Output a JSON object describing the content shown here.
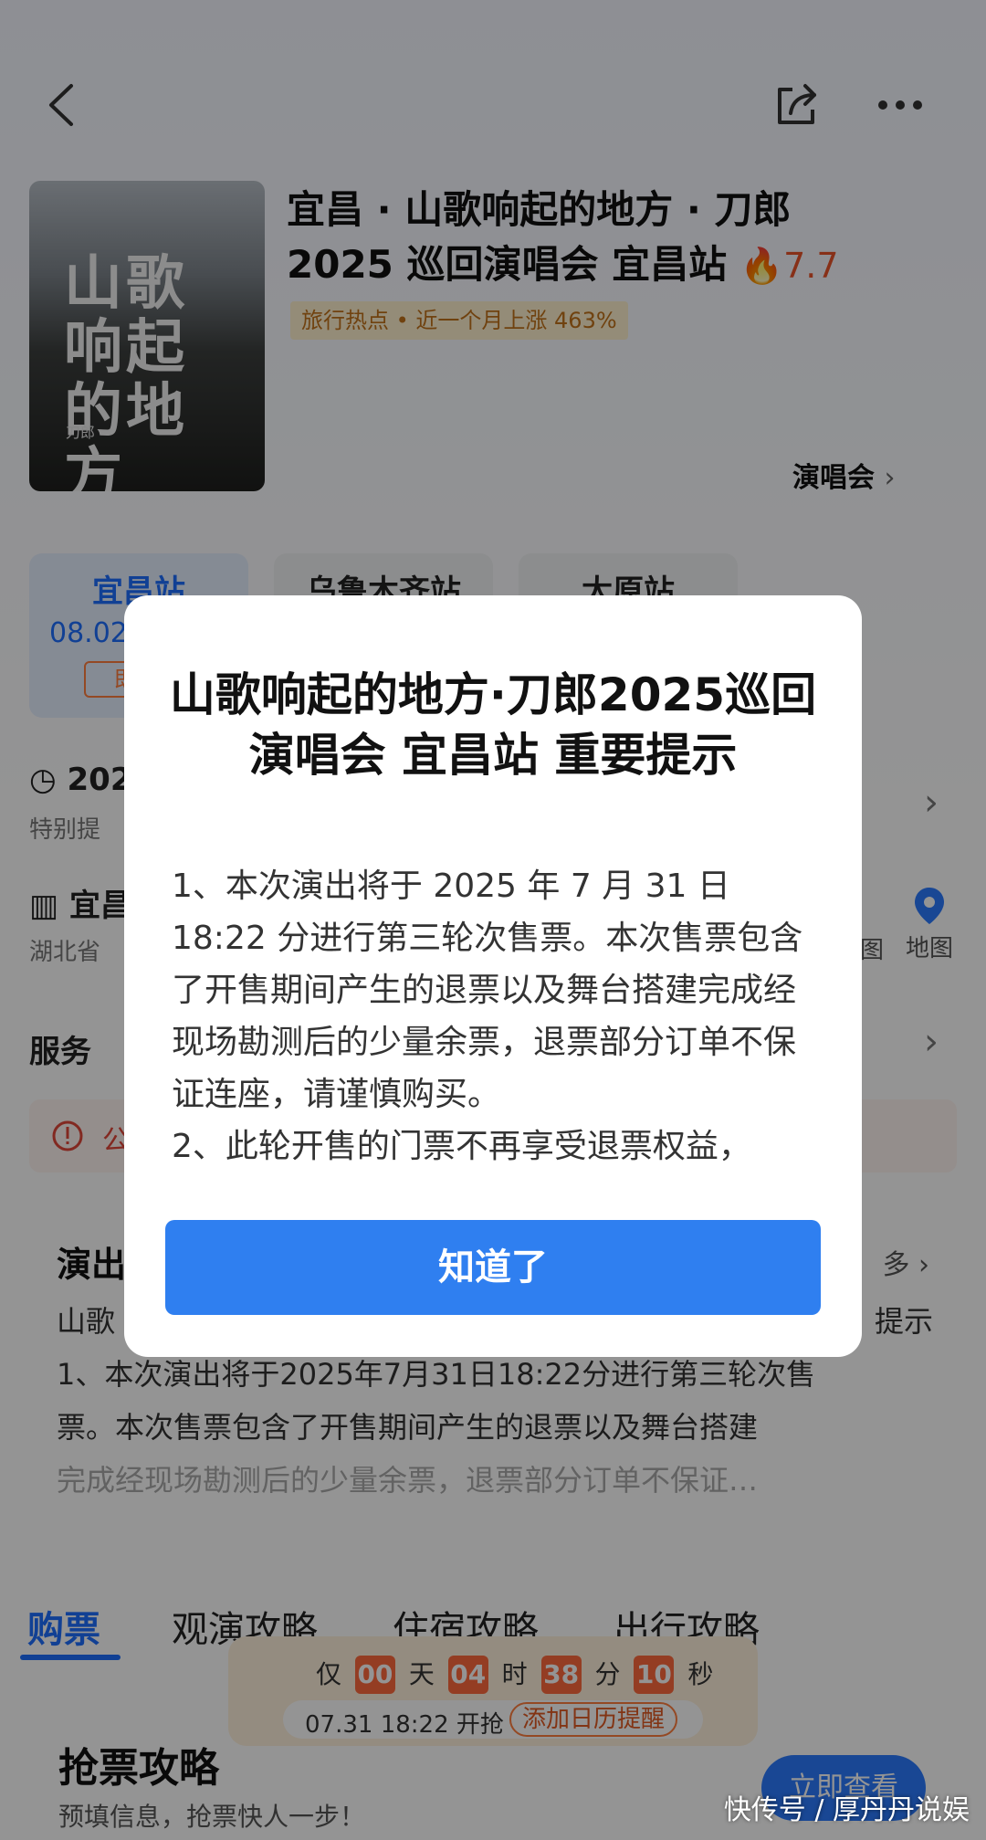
{
  "header": {
    "back_icon": "chevron-left-icon",
    "share_icon": "share-icon",
    "more_icon": "more-icon"
  },
  "event": {
    "poster_title": "山歌响起的地方",
    "poster_artist": "刀郎",
    "title_line1": "宜昌 · 山歌响起的地方 · 刀郎",
    "title_line2": "2025 巡回演唱会 宜昌站",
    "heat": "🔥7.7",
    "hot_tag": "旅行热点 • 近一个月上涨 463%",
    "category": "演唱会"
  },
  "cities": [
    {
      "name": "宜昌站",
      "date": "08.02",
      "badge": "即"
    },
    {
      "name": "乌鲁木齐站"
    },
    {
      "name": "太原站"
    }
  ],
  "info": {
    "time_partial": "202",
    "time_note_partial": "特别提",
    "venue_partial": "宜昌",
    "venue_address_partial": "湖北省",
    "nav_partial": "图",
    "map_label": "地图",
    "service_label": "服务",
    "notice_partial": "公"
  },
  "details": {
    "title": "演出",
    "more": "多",
    "body_line1": "山歌",
    "body_line1_end": "提示",
    "body_line2": "1、本次演出将于2025年7月31日18:22分进行第三轮次售",
    "body_line3": "票。本次售票包含了开售期间产生的退票以及舞台搭建",
    "body_line4": "完成经现场勘测后的少量余票，退票部分订单不保证…"
  },
  "tabs": [
    "购票",
    "观演攻略",
    "住宿攻略",
    "出行攻略"
  ],
  "countdown": {
    "prefix": "仅",
    "days": "00",
    "day_unit": "天",
    "hours": "04",
    "hour_unit": "时",
    "minutes": "38",
    "minute_unit": "分",
    "seconds": "10",
    "second_unit": "秒",
    "start_time": "07.31 18:22 开抢",
    "remind_label": "添加日历提醒"
  },
  "guide": {
    "title": "抢票攻略",
    "subtitle": "预填信息，抢票快人一步！",
    "view_button": "立即查看"
  },
  "modal": {
    "title": "山歌响起的地方·刀郎2025巡回演唱会 宜昌站 重要提示",
    "paragraph1": "1、本次演出将于 2025 年 7 月 31 日 18:22 分进行第三轮次售票。本次售票包含了开售期间产生的退票以及舞台搭建完成经现场勘测后的少量余票，退票部分订单不保证连座，请谨慎购买。",
    "paragraph2": "2、此轮开售的门票不再享受退票权益，",
    "confirm_button": "知道了"
  },
  "watermark": "快传号 / 厚丹丹说娱"
}
